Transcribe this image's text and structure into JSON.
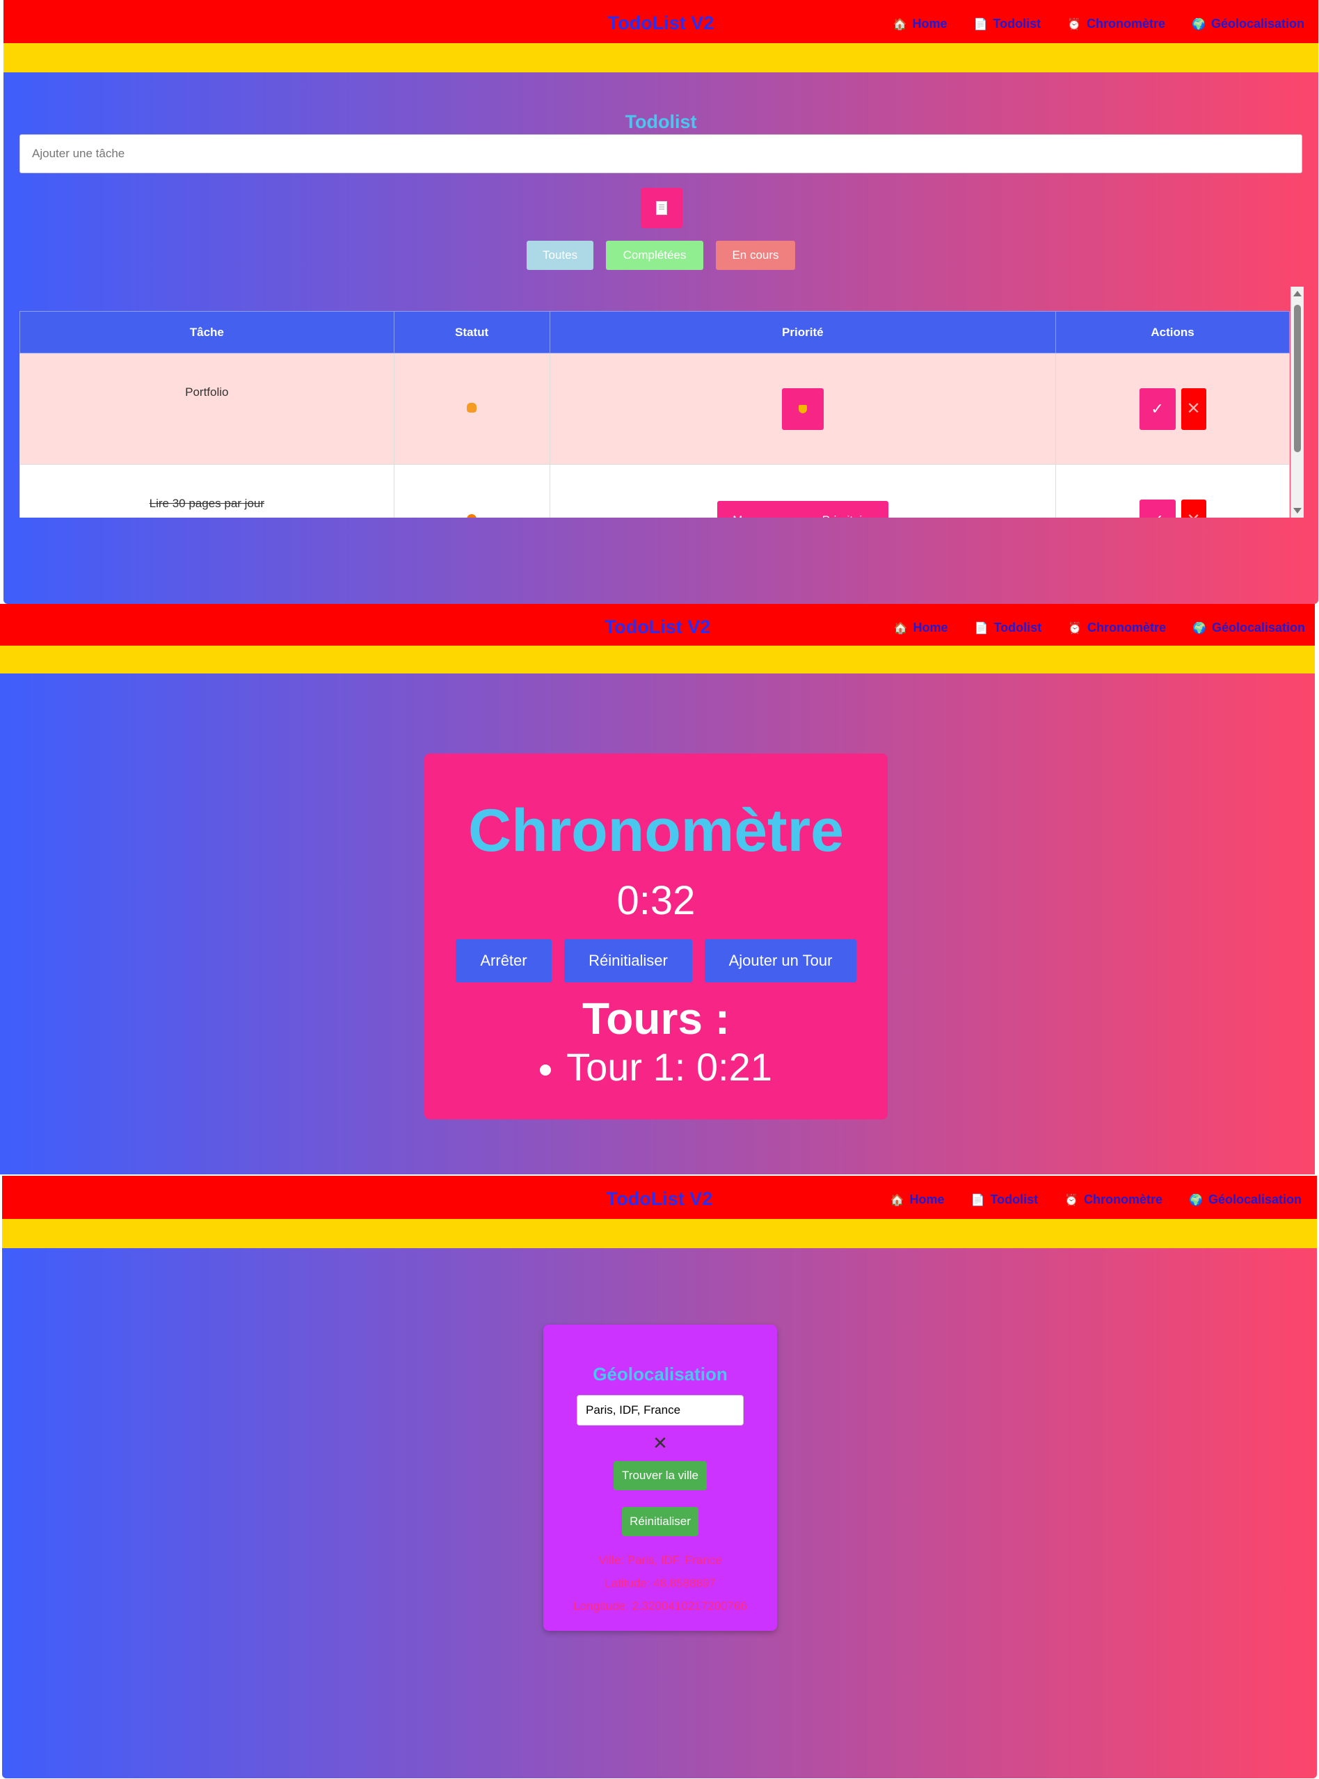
{
  "nav": {
    "title": "TodoList V2",
    "items": [
      {
        "icon": "house-icon",
        "glyph": "🏠",
        "label": "Home"
      },
      {
        "icon": "memo-icon",
        "glyph": "📄",
        "label": "Todolist"
      },
      {
        "icon": "clock-icon",
        "glyph": "⏰",
        "label": "Chronomètre"
      },
      {
        "icon": "globe-icon",
        "glyph": "🌍",
        "label": "Géolocalisation"
      }
    ]
  },
  "todo": {
    "title": "Todolist",
    "input_placeholder": "Ajouter une tâche",
    "filters": [
      "Toutes",
      "Complétées",
      "En cours"
    ],
    "columns": [
      "Tâche",
      "Statut",
      "Priorité",
      "Actions"
    ],
    "rows": [
      {
        "task": "Portfolio",
        "status_icon": "person-icon",
        "priority_icon": "trophy-icon",
        "priority_label": "",
        "completed": false,
        "highlight": true
      },
      {
        "task": "Lire 30 pages par jour",
        "status_icon": "orange-circle-icon",
        "priority_label": "Marquer comme Prioritaire",
        "completed": true,
        "highlight": false
      }
    ],
    "colors": {
      "accent": "#f72585",
      "header": "#4361ee",
      "danger": "#ff0000"
    }
  },
  "chrono": {
    "title": "Chronomètre",
    "time": "0:32",
    "buttons": [
      "Arrêter",
      "Réinitialiser",
      "Ajouter un Tour"
    ],
    "laps_title": "Tours :",
    "laps": [
      "Tour 1: 0:21"
    ]
  },
  "geo": {
    "title": "Géolocalisation",
    "input_value": "Paris, IDF, France",
    "clear_glyph": "✕",
    "find_label": "Trouver la ville",
    "reset_label": "Réinitialiser",
    "ville": "Ville: Paris, IDF, France",
    "latitude": "Latitude: 48.8588897",
    "longitude": "Longitude: 2.3200410217200766"
  }
}
